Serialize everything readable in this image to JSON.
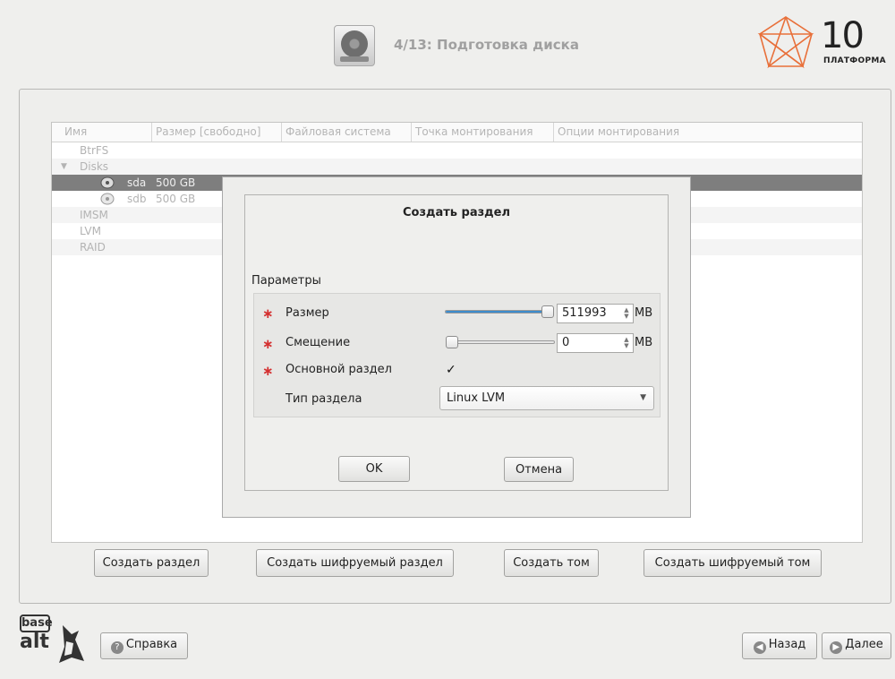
{
  "header": {
    "title": "4/13: Подготовка диска",
    "brand_number": "10",
    "brand_name": "ПЛАТФОРМА"
  },
  "tree": {
    "columns": [
      "Имя",
      "Размер [свободно]",
      "Файловая система",
      "Точка монтирования",
      "Опции монтирования"
    ],
    "rows": [
      {
        "name": "BtrFS",
        "size": ""
      },
      {
        "name": "Disks",
        "size": "",
        "expanded": true
      },
      {
        "name": "sda",
        "size": "500 GB",
        "selected": true
      },
      {
        "name": "sdb",
        "size": "500 GB"
      },
      {
        "name": "IMSM",
        "size": ""
      },
      {
        "name": "LVM",
        "size": ""
      },
      {
        "name": "RAID",
        "size": ""
      }
    ]
  },
  "dialog": {
    "title": "Создать раздел",
    "section": "Параметры",
    "size_label": "Размер",
    "size_value": "511993",
    "size_unit": "MB",
    "size_fraction": 1.0,
    "offset_label": "Смещение",
    "offset_value": "0",
    "offset_unit": "MB",
    "offset_fraction": 0.0,
    "primary_label": "Основной раздел",
    "primary_checked": true,
    "type_label": "Тип раздела",
    "type_value": "Linux LVM",
    "ok": "OK",
    "cancel": "Отмена"
  },
  "actions": {
    "create_partition": "Создать раздел",
    "create_encrypted_partition": "Создать шифруемый раздел",
    "create_volume": "Создать том",
    "create_encrypted_volume": "Создать шифруемый том"
  },
  "footer": {
    "help": "Справка",
    "back": "Назад",
    "next": "Далее",
    "logo_top": "base",
    "logo_bottom": "alt"
  },
  "colors": {
    "accent": "#3d8ccc",
    "required": "#d43030",
    "selected_row": "#7e7e7e"
  },
  "icons": [
    "harddisk-icon",
    "platform-logo-icon",
    "expander-icon",
    "disk-icon",
    "help-icon",
    "back-arrow-icon",
    "next-arrow-icon",
    "basealt-logo-icon"
  ]
}
